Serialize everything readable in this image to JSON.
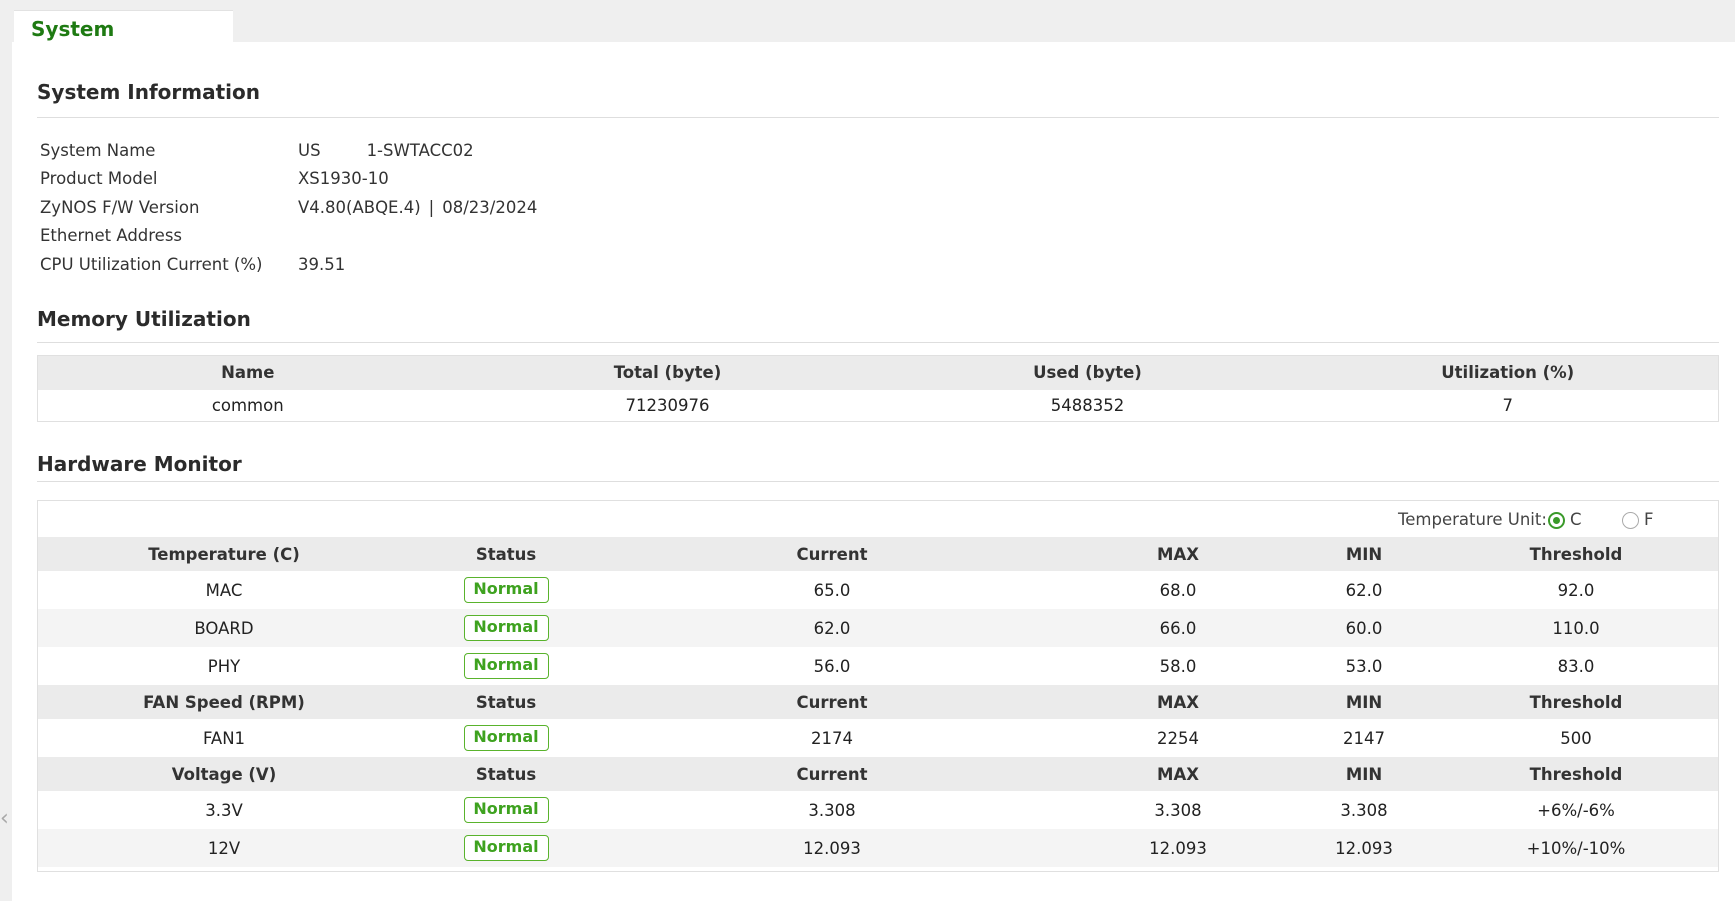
{
  "tab": {
    "label": "System Information"
  },
  "sections": {
    "system_info": "System Information",
    "memory": "Memory Utilization",
    "hardware": "Hardware Monitor"
  },
  "system_info": {
    "system_name": {
      "label": "System Name",
      "value_prefix": "US",
      "value_suffix": "1-SWTACC02"
    },
    "product_model": {
      "label": "Product Model",
      "value": "XS1930-10"
    },
    "firmware": {
      "label": "ZyNOS F/W Version",
      "version": "V4.80(ABQE.4)",
      "separator": "|",
      "date": "08/23/2024"
    },
    "ethernet": {
      "label": "Ethernet Address",
      "value": ""
    },
    "cpu": {
      "label": "CPU Utilization Current (%)",
      "value": "39.51"
    }
  },
  "memory_table": {
    "headers": [
      "Name",
      "Total (byte)",
      "Used (byte)",
      "Utilization (%)"
    ],
    "rows": [
      [
        "common",
        "71230976",
        "5488352",
        "7"
      ]
    ]
  },
  "hardware_monitor": {
    "temp_unit": {
      "label": "Temperature Unit:",
      "options": [
        "C",
        "F"
      ],
      "selected": "C"
    },
    "temperature": {
      "headers": [
        "Temperature (C)",
        "Status",
        "Current",
        "MAX",
        "MIN",
        "Threshold"
      ],
      "rows": [
        [
          "MAC",
          "Normal",
          "65.0",
          "68.0",
          "62.0",
          "92.0"
        ],
        [
          "BOARD",
          "Normal",
          "62.0",
          "66.0",
          "60.0",
          "110.0"
        ],
        [
          "PHY",
          "Normal",
          "56.0",
          "58.0",
          "53.0",
          "83.0"
        ]
      ]
    },
    "fan": {
      "headers": [
        "FAN Speed (RPM)",
        "Status",
        "Current",
        "MAX",
        "MIN",
        "Threshold"
      ],
      "rows": [
        [
          "FAN1",
          "Normal",
          "2174",
          "2254",
          "2147",
          "500"
        ]
      ]
    },
    "voltage": {
      "headers": [
        "Voltage (V)",
        "Status",
        "Current",
        "MAX",
        "MIN",
        "Threshold"
      ],
      "rows": [
        [
          "3.3V",
          "Normal",
          "3.308",
          "3.308",
          "3.308",
          "+6%/-6%"
        ],
        [
          "12V",
          "Normal",
          "12.093",
          "12.093",
          "12.093",
          "+10%/-10%"
        ]
      ]
    }
  },
  "colors": {
    "accent": "#1e7a12",
    "status_ok": "#59b32c",
    "header_bg": "#ebebeb",
    "panel_bg": "#ffffff"
  },
  "icons": {
    "back": "chevron-left-icon"
  }
}
